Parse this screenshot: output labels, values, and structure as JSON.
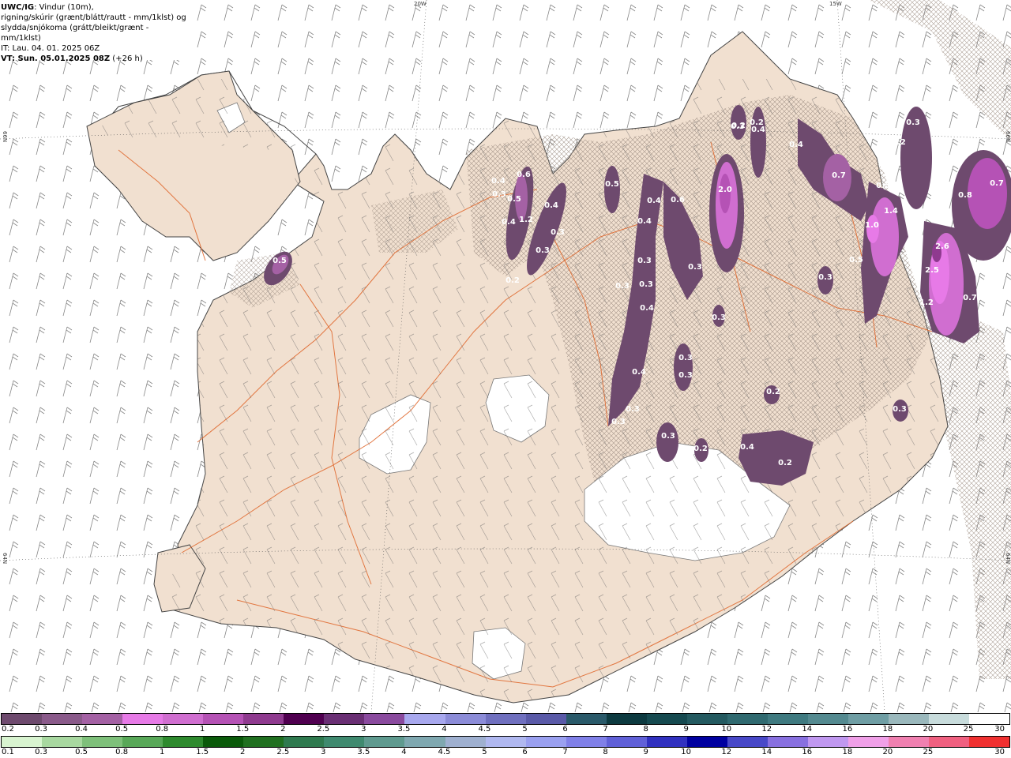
{
  "header": {
    "title": "UWC/IG",
    "title_suffix": ": Vindur (10m),",
    "line2": "rigning/skúrir (grænt/blátt/rautt - mm/1klst) og",
    "line3": "slydda/snjókoma (grátt/bleikt/grænt - mm/1klst)",
    "it": "IT: Lau. 04. 01. 2025 06Z",
    "vt": "VT: Sun. 05.01.2025 08Z",
    "vt_offset": " (+26 h)"
  },
  "grid_labels": {
    "lon_20w": "20W",
    "lon_15w": "15W",
    "lat_66n_left": "66N",
    "lat_66n_right": "66N",
    "lat_64n_left": "64N",
    "lat_64n_right": "64N"
  },
  "precip_values": [
    "0.2",
    "0.3",
    "0.3",
    "0.4",
    "0.4",
    "0.7",
    "0.5",
    "1.4",
    "1.0",
    "2.6",
    "2.5",
    "1.2",
    "0.7",
    "0.8",
    "0.7",
    "0.2",
    "0.2",
    "2.0",
    "0.5",
    "0.6",
    "0.4",
    "0.4",
    "0.4",
    "0.3",
    "0.3",
    "0.3",
    "0.5",
    "0.3",
    "0.3",
    "0.6",
    "0.5",
    "1.2",
    "0.4",
    "0.4",
    "0.3",
    "0.4",
    "0.3",
    "0.3",
    "0.3",
    "0.2",
    "0.4",
    "0.4",
    "0.3",
    "0.3",
    "0.2",
    "0.3",
    "0.3",
    "0.5",
    "0.2",
    "0.3",
    "0.3",
    "0.2"
  ],
  "legend": {
    "row1_colors": [
      "#6e4a6e",
      "#8a5a8a",
      "#a461a4",
      "#e77ae7",
      "#d06ed0",
      "#b552b5",
      "#8f3a8f",
      "#500050",
      "#6a2f74",
      "#8a4a9e",
      "#a8a8ee",
      "#8c8cd8",
      "#7070bf",
      "#5a5aa8",
      "#2a5a6a",
      "#0d3a40",
      "#164a50",
      "#245a60",
      "#306a70",
      "#3f7a80",
      "#548a90",
      "#6f9ea4",
      "#9ab8bc",
      "#c8dcdc",
      "#ffffff"
    ],
    "row1_labels": [
      "0.2",
      "0.3",
      "0.4",
      "0.5",
      "0.8",
      "1",
      "1.5",
      "2",
      "2.5",
      "3",
      "3.5",
      "4",
      "4.5",
      "5",
      "6",
      "7",
      "8",
      "9",
      "10",
      "12",
      "14",
      "16",
      "18",
      "20",
      "25",
      "30"
    ],
    "row2_colors": [
      "#d8f4d0",
      "#a8d8a0",
      "#7ec07a",
      "#58a858",
      "#2e8a2e",
      "#0a5a0a",
      "#207020",
      "#2f7a4f",
      "#3f8a6f",
      "#5f9a8f",
      "#7fa8b0",
      "#9fb0d0",
      "#b0b8f0",
      "#9aa0f0",
      "#8080e8",
      "#6060d8",
      "#3030c0",
      "#0000a0",
      "#4848c8",
      "#8870e0",
      "#c098f0",
      "#f0a0e8",
      "#f080b0",
      "#f06080",
      "#f03030"
    ],
    "row2_labels": [
      "0.1",
      "0.3",
      "0.5",
      "0.8",
      "1",
      "1.5",
      "2",
      "2.5",
      "3",
      "3.5",
      "4",
      "4.5",
      "5",
      "6",
      "7",
      "8",
      "9",
      "10",
      "12",
      "14",
      "16",
      "18",
      "20",
      "25",
      "30"
    ]
  }
}
